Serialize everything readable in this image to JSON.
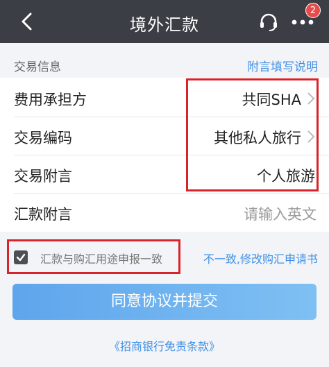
{
  "header": {
    "title": "境外汇款",
    "badge_count": "2"
  },
  "section": {
    "title": "交易信息",
    "help_link": "附言填写说明"
  },
  "rows": [
    {
      "label": "费用承担方",
      "value": "共同SHA"
    },
    {
      "label": "交易编码",
      "value": "其他私人旅行"
    },
    {
      "label": "交易附言",
      "value": "个人旅游"
    },
    {
      "label": "汇款附言",
      "placeholder": "请输入英文"
    }
  ],
  "consent": {
    "label": "汇款与购汇用途申报一致",
    "checked": true,
    "mismatch_link": "不一致,修改购汇申请书"
  },
  "submit_label": "同意协议并提交",
  "disclaimer_link": "《招商银行免责条款》",
  "colors": {
    "header_bg": "#3b3e44",
    "link": "#3f8fe6",
    "highlight": "#d8232a",
    "button_start": "#5ea5ec",
    "button_end": "#7fc0f3"
  }
}
